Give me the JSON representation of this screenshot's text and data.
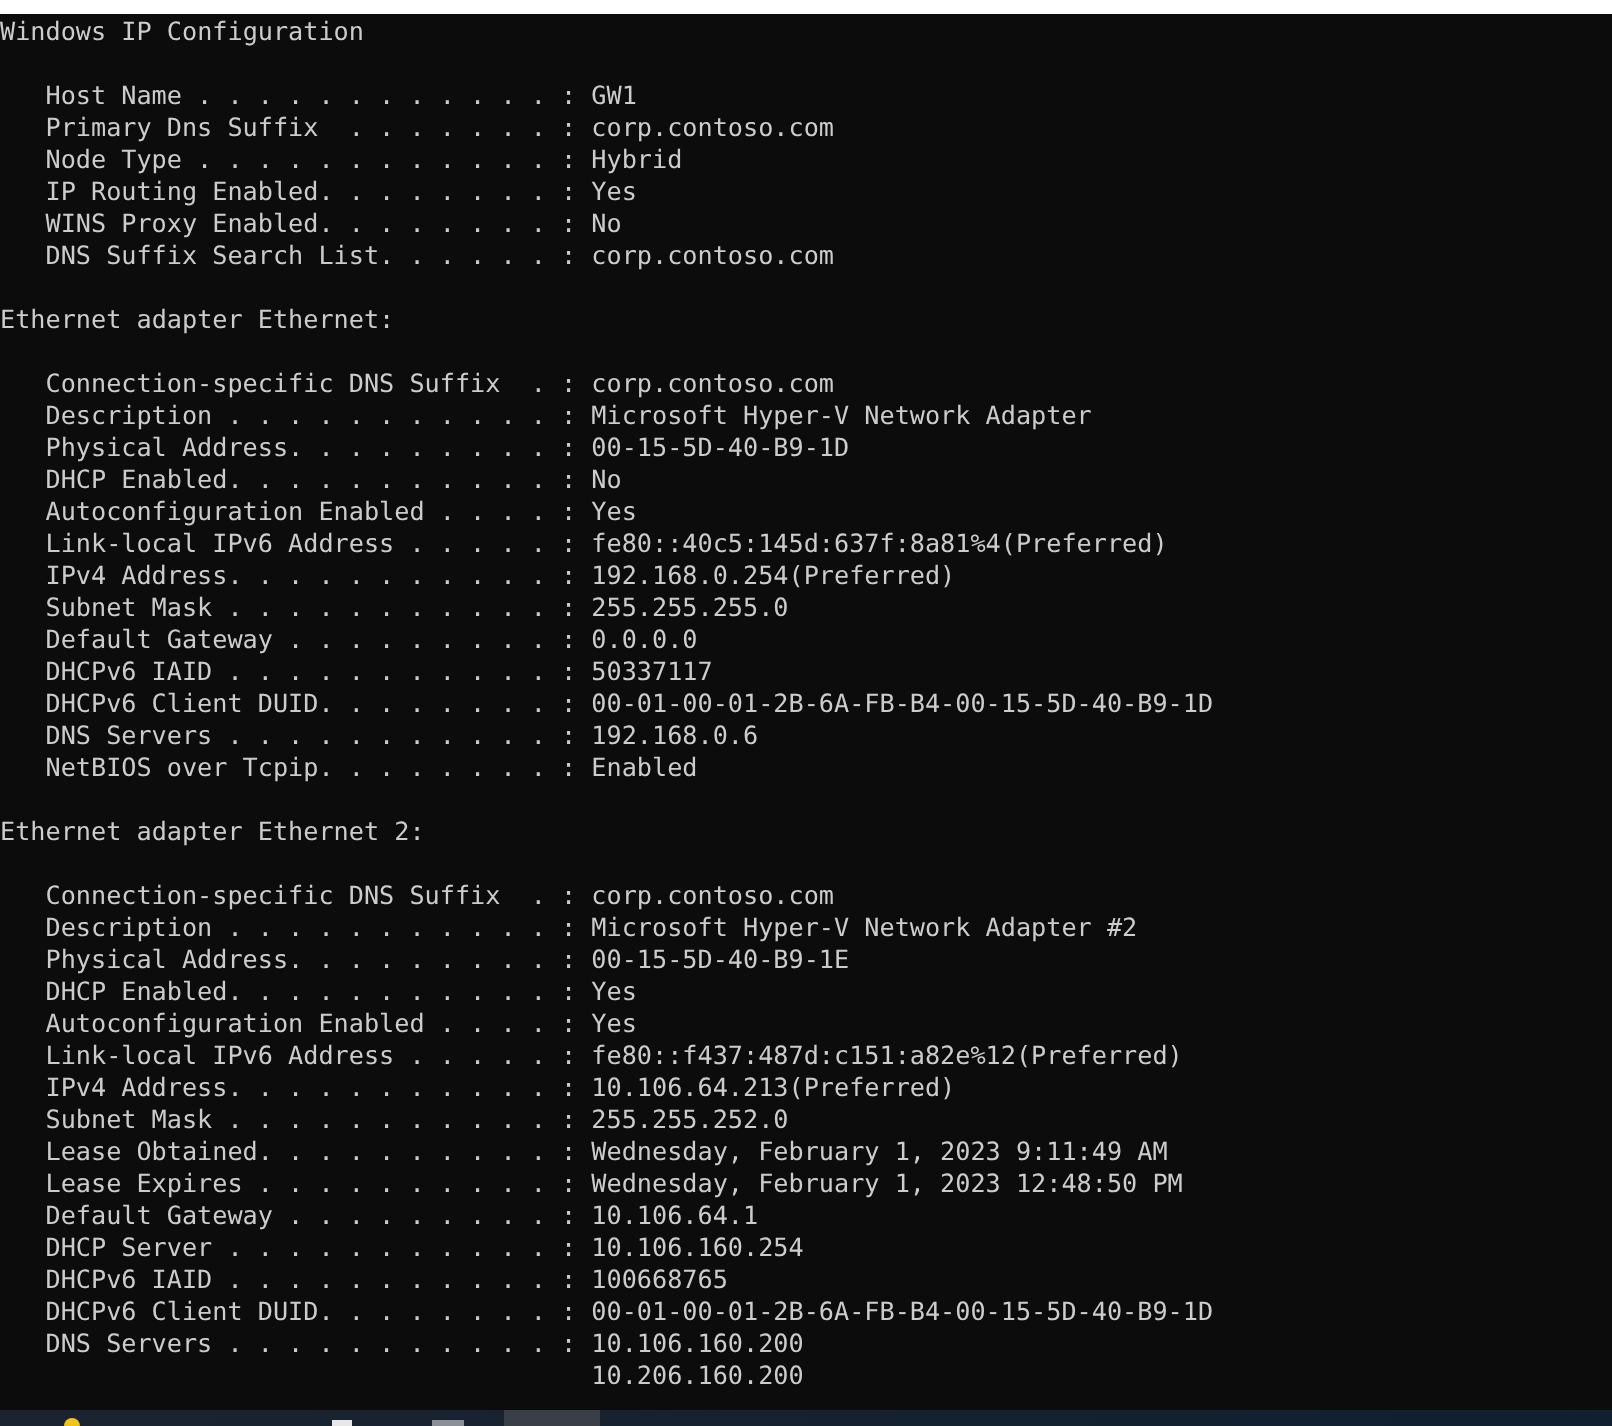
{
  "console": {
    "title": "Windows IP Configuration",
    "global": [
      {
        "label": "Host Name . . . . . . . . . . . . :",
        "values": [
          "GW1"
        ]
      },
      {
        "label": "Primary Dns Suffix  . . . . . . . :",
        "values": [
          "corp.contoso.com"
        ]
      },
      {
        "label": "Node Type . . . . . . . . . . . . :",
        "values": [
          "Hybrid"
        ]
      },
      {
        "label": "IP Routing Enabled. . . . . . . . :",
        "values": [
          "Yes"
        ]
      },
      {
        "label": "WINS Proxy Enabled. . . . . . . . :",
        "values": [
          "No"
        ]
      },
      {
        "label": "DNS Suffix Search List. . . . . . :",
        "values": [
          "corp.contoso.com"
        ]
      }
    ],
    "adapters": [
      {
        "heading": "Ethernet adapter Ethernet:",
        "entries": [
          {
            "label": "Connection-specific DNS Suffix  . :",
            "values": [
              "corp.contoso.com"
            ]
          },
          {
            "label": "Description . . . . . . . . . . . :",
            "values": [
              "Microsoft Hyper-V Network Adapter"
            ]
          },
          {
            "label": "Physical Address. . . . . . . . . :",
            "values": [
              "00-15-5D-40-B9-1D"
            ]
          },
          {
            "label": "DHCP Enabled. . . . . . . . . . . :",
            "values": [
              "No"
            ]
          },
          {
            "label": "Autoconfiguration Enabled . . . . :",
            "values": [
              "Yes"
            ]
          },
          {
            "label": "Link-local IPv6 Address . . . . . :",
            "values": [
              "fe80::40c5:145d:637f:8a81%4(Preferred)"
            ]
          },
          {
            "label": "IPv4 Address. . . . . . . . . . . :",
            "values": [
              "192.168.0.254(Preferred)"
            ]
          },
          {
            "label": "Subnet Mask . . . . . . . . . . . :",
            "values": [
              "255.255.255.0"
            ]
          },
          {
            "label": "Default Gateway . . . . . . . . . :",
            "values": [
              "0.0.0.0"
            ]
          },
          {
            "label": "DHCPv6 IAID . . . . . . . . . . . :",
            "values": [
              "50337117"
            ]
          },
          {
            "label": "DHCPv6 Client DUID. . . . . . . . :",
            "values": [
              "00-01-00-01-2B-6A-FB-B4-00-15-5D-40-B9-1D"
            ]
          },
          {
            "label": "DNS Servers . . . . . . . . . . . :",
            "values": [
              "192.168.0.6"
            ]
          },
          {
            "label": "NetBIOS over Tcpip. . . . . . . . :",
            "values": [
              "Enabled"
            ]
          }
        ]
      },
      {
        "heading": "Ethernet adapter Ethernet 2:",
        "entries": [
          {
            "label": "Connection-specific DNS Suffix  . :",
            "values": [
              "corp.contoso.com"
            ]
          },
          {
            "label": "Description . . . . . . . . . . . :",
            "values": [
              "Microsoft Hyper-V Network Adapter #2"
            ]
          },
          {
            "label": "Physical Address. . . . . . . . . :",
            "values": [
              "00-15-5D-40-B9-1E"
            ]
          },
          {
            "label": "DHCP Enabled. . . . . . . . . . . :",
            "values": [
              "Yes"
            ]
          },
          {
            "label": "Autoconfiguration Enabled . . . . :",
            "values": [
              "Yes"
            ]
          },
          {
            "label": "Link-local IPv6 Address . . . . . :",
            "values": [
              "fe80::f437:487d:c151:a82e%12(Preferred)"
            ]
          },
          {
            "label": "IPv4 Address. . . . . . . . . . . :",
            "values": [
              "10.106.64.213(Preferred)"
            ]
          },
          {
            "label": "Subnet Mask . . . . . . . . . . . :",
            "values": [
              "255.255.252.0"
            ]
          },
          {
            "label": "Lease Obtained. . . . . . . . . . :",
            "values": [
              "Wednesday, February 1, 2023 9:11:49 AM"
            ]
          },
          {
            "label": "Lease Expires . . . . . . . . . . :",
            "values": [
              "Wednesday, February 1, 2023 12:48:50 PM"
            ]
          },
          {
            "label": "Default Gateway . . . . . . . . . :",
            "values": [
              "10.106.64.1"
            ]
          },
          {
            "label": "DHCP Server . . . . . . . . . . . :",
            "values": [
              "10.106.160.254"
            ]
          },
          {
            "label": "DHCPv6 IAID . . . . . . . . . . . :",
            "values": [
              "100668765"
            ]
          },
          {
            "label": "DHCPv6 Client DUID. . . . . . . . :",
            "values": [
              "00-01-00-01-2B-6A-FB-B4-00-15-5D-40-B9-1D"
            ]
          },
          {
            "label": "DNS Servers . . . . . . . . . . . :",
            "values": [
              "10.106.160.200",
              "10.206.160.200"
            ]
          }
        ]
      }
    ]
  }
}
